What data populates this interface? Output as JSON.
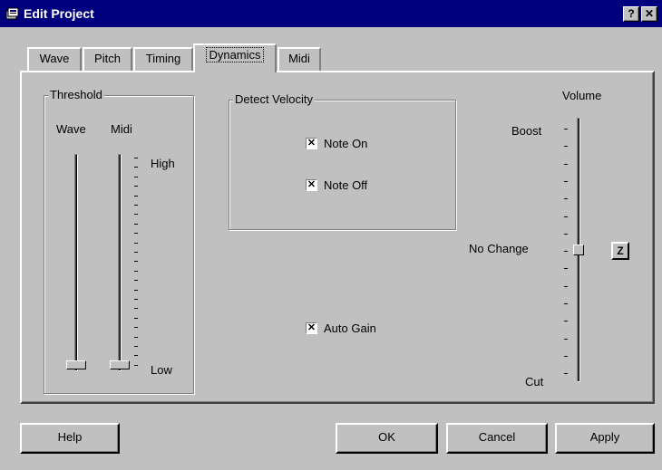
{
  "window": {
    "title": "Edit Project",
    "help_button": "?",
    "close_button": "✕"
  },
  "tabs": [
    {
      "label": "Wave",
      "active": false
    },
    {
      "label": "Pitch",
      "active": false
    },
    {
      "label": "Timing",
      "active": false
    },
    {
      "label": "Dynamics",
      "active": true
    },
    {
      "label": "Midi",
      "active": false
    }
  ],
  "threshold": {
    "group_label": "Threshold",
    "wave_label": "Wave",
    "midi_label": "Midi",
    "high_label": "High",
    "low_label": "Low",
    "wave_level": 0,
    "midi_level": 0
  },
  "detect_velocity": {
    "group_label": "Detect Velocity",
    "note_on": {
      "label": "Note On",
      "checked": true
    },
    "note_off": {
      "label": "Note Off",
      "checked": true
    }
  },
  "auto_gain": {
    "label": "Auto Gain",
    "checked": true
  },
  "volume": {
    "label": "Volume",
    "boost_label": "Boost",
    "no_change_label": "No Change",
    "cut_label": "Cut",
    "level": 0.5,
    "z_button": "Z"
  },
  "buttons": {
    "help": "Help",
    "ok": "OK",
    "cancel": "Cancel",
    "apply": "Apply"
  },
  "colors": {
    "titlebar": "#00007f",
    "face": "#c0c0c0"
  }
}
